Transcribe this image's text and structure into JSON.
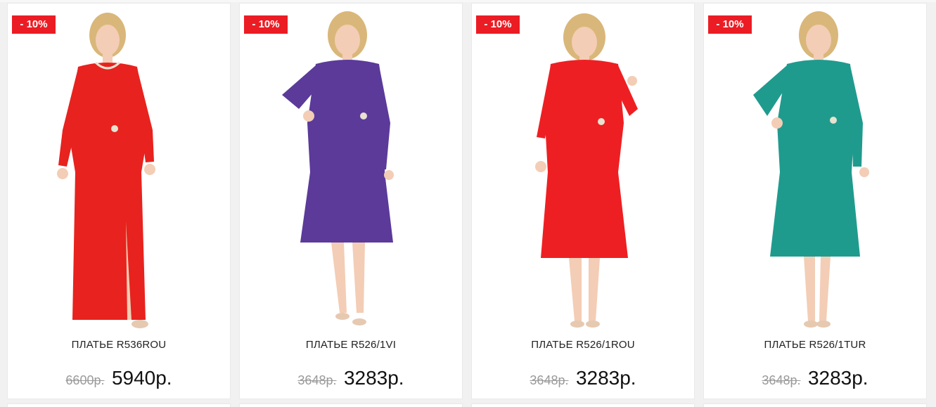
{
  "products": [
    {
      "badge": "- 10%",
      "title": "ПЛАТЬЕ R536ROU",
      "old_price": "6600р.",
      "new_price": "5940р.",
      "dress_color": "#e8221e",
      "style": "long"
    },
    {
      "badge": "- 10%",
      "title": "ПЛАТЬЕ R526/1VI",
      "old_price": "3648р.",
      "new_price": "3283р.",
      "dress_color": "#5b3a9a",
      "style": "midi"
    },
    {
      "badge": "- 10%",
      "title": "ПЛАТЬЕ R526/1ROU",
      "old_price": "3648р.",
      "new_price": "3283р.",
      "dress_color": "#ee1f22",
      "style": "midi"
    },
    {
      "badge": "- 10%",
      "title": "ПЛАТЬЕ R526/1TUR",
      "old_price": "3648р.",
      "new_price": "3283р.",
      "dress_color": "#1f9b8e",
      "style": "midi"
    }
  ],
  "colors": {
    "badge": "#ec1c24",
    "skin": "#f3cdb5",
    "hair": "#d9b77a"
  }
}
